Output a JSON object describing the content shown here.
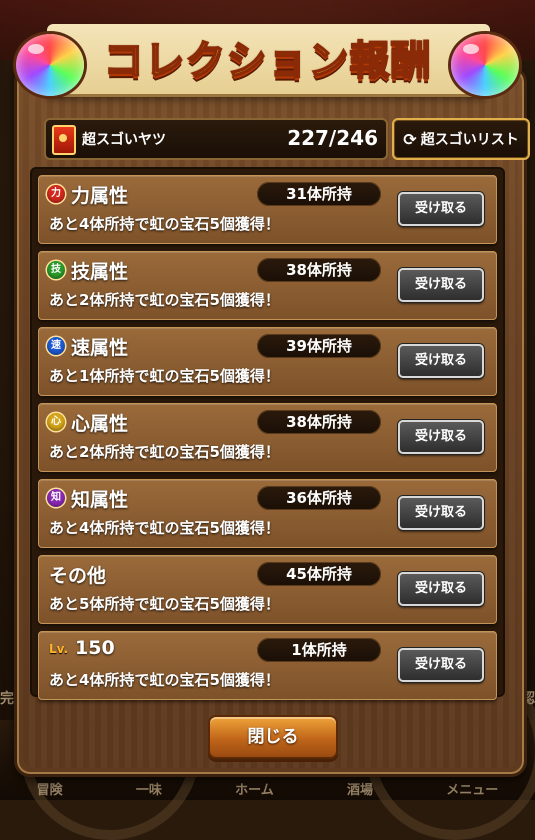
{
  "background": {
    "left_text": "完成",
    "right_text": "確認",
    "bottom_labels": [
      "冒険",
      "一味",
      "ホーム",
      "酒場",
      "メニュー"
    ]
  },
  "title": "コレクション報酬",
  "header": {
    "category_label": "超スゴいヤツ",
    "count": "227/246",
    "list_button": "超スゴいリスト",
    "list_icon": "refresh-icon"
  },
  "rows": [
    {
      "icon_char": "力",
      "icon_color": "#d4281c",
      "name": "力属性",
      "owned": "31体所持",
      "reward": "あと4体所持で虹の宝石5個獲得！",
      "button": "受け取る"
    },
    {
      "icon_char": "技",
      "icon_color": "#2a9a2a",
      "name": "技属性",
      "owned": "38体所持",
      "reward": "あと2体所持で虹の宝石5個獲得！",
      "button": "受け取る"
    },
    {
      "icon_char": "速",
      "icon_color": "#1e5ad4",
      "name": "速属性",
      "owned": "39体所持",
      "reward": "あと1体所持で虹の宝石5個獲得！",
      "button": "受け取る"
    },
    {
      "icon_char": "心",
      "icon_color": "#d4a41a",
      "name": "心属性",
      "owned": "38体所持",
      "reward": "あと2体所持で虹の宝石5個獲得！",
      "button": "受け取る"
    },
    {
      "icon_char": "知",
      "icon_color": "#8a2ab4",
      "name": "知属性",
      "owned": "36体所持",
      "reward": "あと4体所持で虹の宝石5個獲得！",
      "button": "受け取る"
    },
    {
      "icon_char": "",
      "icon_color": "",
      "name": "その他",
      "owned": "45体所持",
      "reward": "あと5体所持で虹の宝石5個獲得！",
      "button": "受け取る"
    },
    {
      "lv_label": "Lv.",
      "name": "150",
      "owned": "1体所持",
      "reward": "あと4体所持で虹の宝石5個獲得！",
      "button": "受け取る"
    }
  ],
  "close_button": "閉じる"
}
